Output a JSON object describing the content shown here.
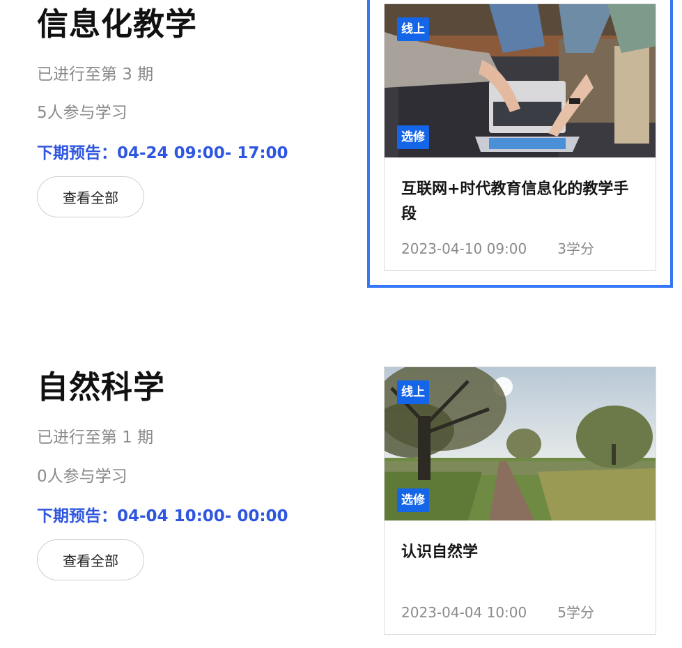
{
  "courses": [
    {
      "title": "信息化教学",
      "progress": "已进行至第 3 期",
      "learners": "5人参与学习",
      "preview": "下期预告：04-24 09:00- 17:00",
      "view_all": "查看全部",
      "card": {
        "badge_top": "线上",
        "badge_bottom": "选修",
        "title": "互联网+时代教育信息化的教学手段",
        "date": "2023-04-10 09:00",
        "credits": "3学分",
        "image": "laptop-hands-photo"
      }
    },
    {
      "title": "自然科学",
      "progress": "已进行至第 1 期",
      "learners": "0人参与学习",
      "preview": "下期预告：04-04 10:00- 00:00",
      "view_all": "查看全部",
      "card": {
        "badge_top": "线上",
        "badge_bottom": "选修",
        "title": "认识自然学",
        "date": "2023-04-04 10:00",
        "credits": "5学分",
        "image": "tree-field-photo"
      }
    }
  ],
  "colors": {
    "accent": "#2f56e0",
    "badge": "#1565e8",
    "highlight": "#3478f6",
    "muted": "#8a8a8a"
  }
}
